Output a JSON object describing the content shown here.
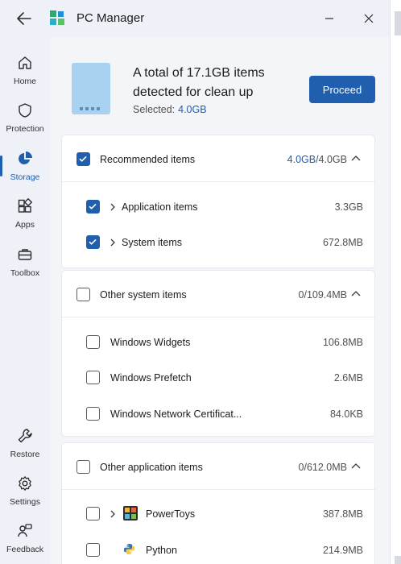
{
  "app": {
    "title": "PC Manager"
  },
  "sidebar": {
    "items": [
      {
        "label": "Home"
      },
      {
        "label": "Protection"
      },
      {
        "label": "Storage"
      },
      {
        "label": "Apps"
      },
      {
        "label": "Toolbox"
      },
      {
        "label": "Restore"
      },
      {
        "label": "Settings"
      },
      {
        "label": "Feedback"
      }
    ],
    "active": "Storage"
  },
  "summary": {
    "title": "A total of 17.1GB items detected for clean up",
    "selected_label": "Selected:",
    "selected_value": "4.0GB",
    "proceed_label": "Proceed"
  },
  "groups": [
    {
      "label": "Recommended items",
      "size_selected": "4.0GB",
      "size_total": "/4.0GB",
      "checked": true,
      "items": [
        {
          "label": "Application items",
          "size": "3.3GB",
          "checked": true,
          "expandable": true
        },
        {
          "label": "System items",
          "size": "672.8MB",
          "checked": true,
          "expandable": true
        }
      ]
    },
    {
      "label": "Other system items",
      "size": "0/109.4MB",
      "checked": false,
      "items": [
        {
          "label": "Windows Widgets",
          "size": "106.8MB",
          "checked": false
        },
        {
          "label": "Windows Prefetch",
          "size": "2.6MB",
          "checked": false
        },
        {
          "label": "Windows Network Certificat...",
          "size": "84.0KB",
          "checked": false
        }
      ]
    },
    {
      "label": "Other application items",
      "size": "0/612.0MB",
      "checked": false,
      "items": [
        {
          "label": "PowerToys",
          "size": "387.8MB",
          "checked": false,
          "expandable": true,
          "icon": "powertoys-icon"
        },
        {
          "label": "Python",
          "size": "214.9MB",
          "checked": false,
          "icon": "python-icon"
        }
      ]
    }
  ],
  "colors": {
    "accent": "#1f5fae",
    "background": "#eef2f8",
    "card": "#ffffff"
  }
}
